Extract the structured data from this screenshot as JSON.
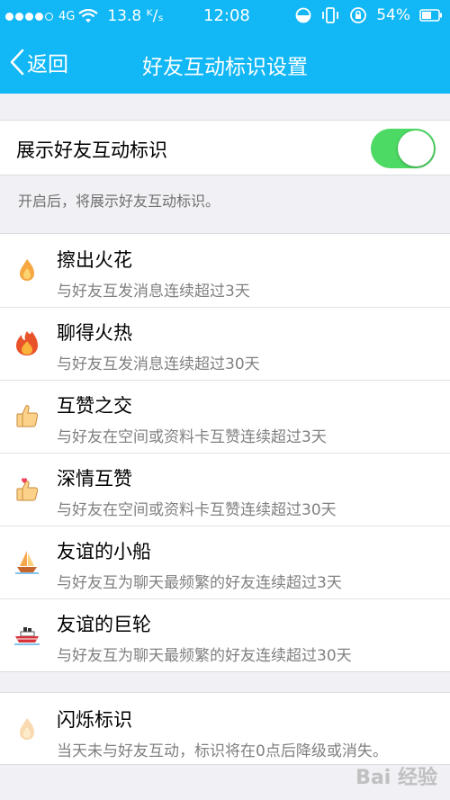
{
  "status_bar": {
    "network": "4G",
    "speed": "13.8 ᴷ/ₛ",
    "time": "12:08",
    "battery": "54%"
  },
  "nav": {
    "back_label": "返回",
    "title": "好友互动标识设置"
  },
  "toggle_row": {
    "label": "展示好友互动标识",
    "enabled": true
  },
  "hint": "开启后，将展示好友互动标识。",
  "badges": [
    {
      "title": "擦出火花",
      "desc": "与好友互发消息连续超过3天",
      "icon": "spark-flame-icon"
    },
    {
      "title": "聊得火热",
      "desc": "与好友互发消息连续超过30天",
      "icon": "big-fire-icon"
    },
    {
      "title": "互赞之交",
      "desc": "与好友在空间或资料卡互赞连续超过3天",
      "icon": "thumbs-up-icon"
    },
    {
      "title": "深情互赞",
      "desc": "与好友在空间或资料卡互赞连续超过30天",
      "icon": "thumbs-up-heart-icon"
    },
    {
      "title": "友谊的小船",
      "desc": "与好友互为聊天最频繁的好友连续超过3天",
      "icon": "sailboat-icon"
    },
    {
      "title": "友谊的巨轮",
      "desc": "与好友互为聊天最频繁的好友连续超过30天",
      "icon": "ocean-liner-icon"
    }
  ],
  "flash": {
    "title": "闪烁标识",
    "desc": "当天未与好友互动，标识将在0点后降级或消失。",
    "icon": "faded-flame-icon"
  },
  "watermark": "Bai 经验",
  "colors": {
    "header": "#12b7f5",
    "toggle_on": "#4cd964",
    "background": "#f0f0f5"
  }
}
